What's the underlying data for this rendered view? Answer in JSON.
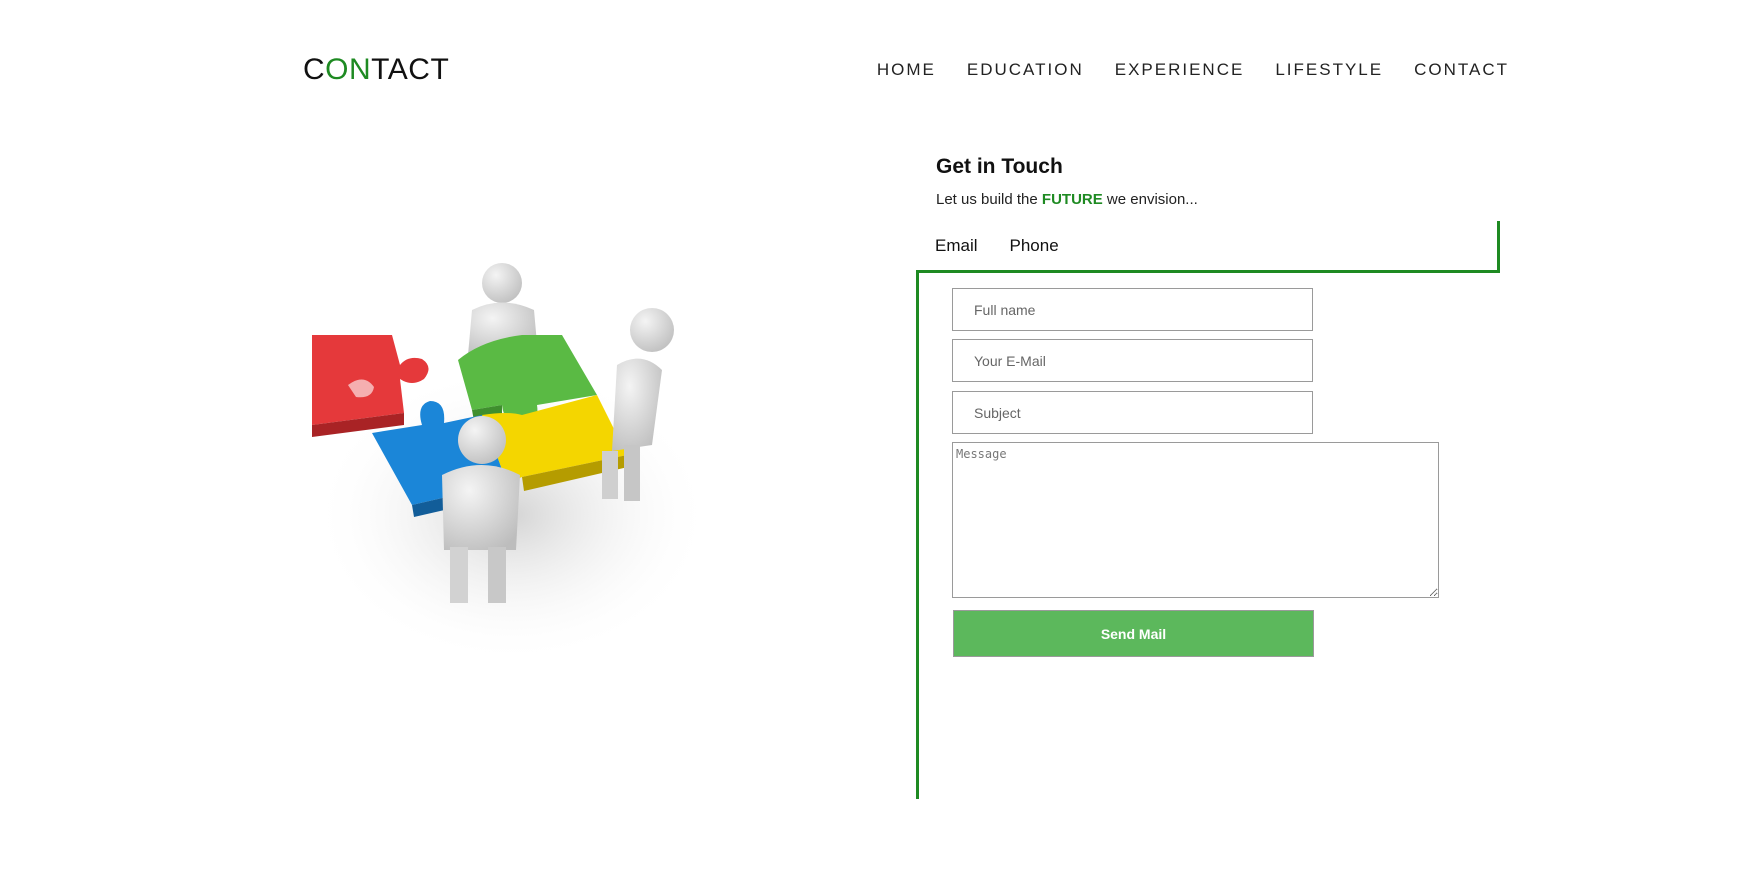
{
  "header": {
    "logo_parts": [
      "C",
      "ON",
      "TACT"
    ],
    "nav": [
      "HOME",
      "EDUCATION",
      "EXPERIENCE",
      "LIFESTYLE",
      "CONTACT"
    ]
  },
  "contact": {
    "title": "Get in Touch",
    "tagline_prefix": "Let us build the ",
    "tagline_highlight": "FUTURE",
    "tagline_suffix": " we envision...",
    "tabs": [
      "Email",
      "Phone"
    ],
    "form": {
      "name_placeholder": "Full name",
      "email_placeholder": "Your E-Mail",
      "subject_placeholder": "Subject",
      "message_placeholder": "Message",
      "submit_label": "Send Mail"
    }
  },
  "colors": {
    "accent": "#1e8a22",
    "button": "#5cb85c"
  },
  "hero_image": {
    "icon": "puzzle-team-illustration"
  }
}
